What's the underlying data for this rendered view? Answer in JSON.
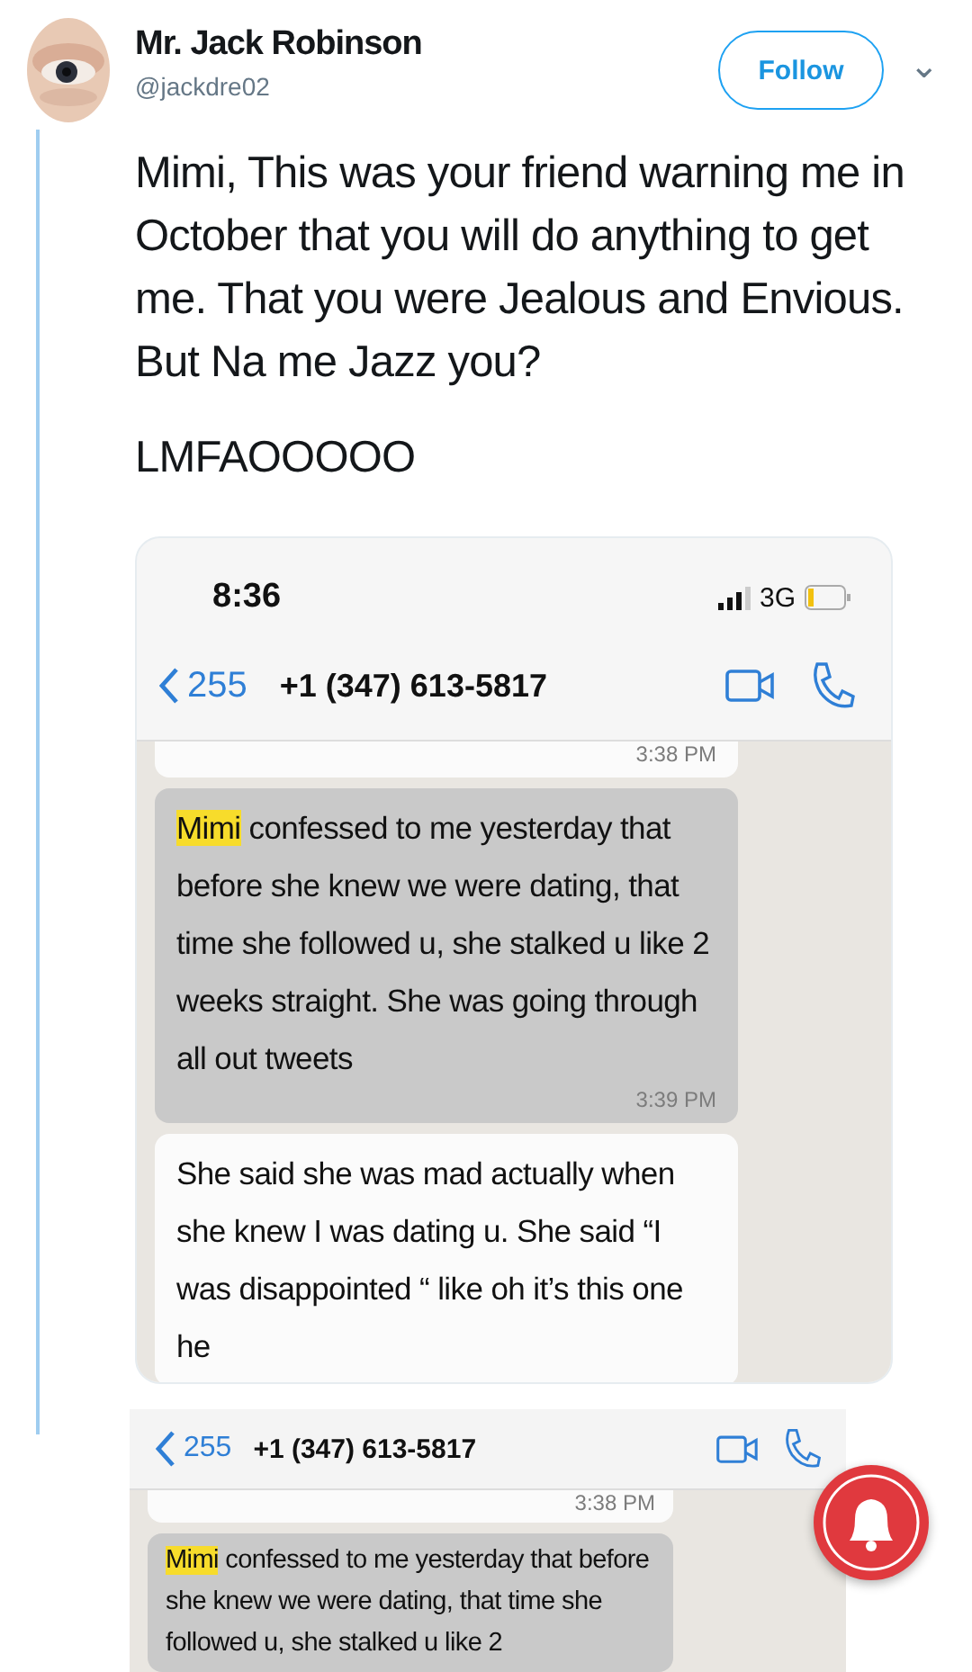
{
  "tweet": {
    "author": {
      "name": "Mr. Jack Robinson",
      "handle": "@jackdre02"
    },
    "follow_button": "Follow",
    "menu_caret": "⌄",
    "paragraphs": [
      "Mimi, This was your friend warning me in October that you will do anything to get me. That you were Jealous and Envious. But Na me Jazz you?",
      "LMFAOOOOO"
    ]
  },
  "screenshot": {
    "status_bar": {
      "time": "8:36",
      "network": "3G"
    },
    "chat_header": {
      "back_count": "255",
      "contact": "+1 (347) 613-5817"
    },
    "messages": [
      {
        "kind": "timestamp_only",
        "time": "3:38 PM"
      },
      {
        "kind": "highlighted",
        "highlight": "Mimi",
        "text": " confessed to me yesterday that before she knew we were dating, that time she followed u, she stalked u like 2 weeks straight. She was going through all out tweets",
        "time": "3:39 PM"
      },
      {
        "kind": "plain",
        "text": "She said she was mad actually when she knew I was dating u. She said “I was disappointed “ like oh it’s this one he"
      }
    ]
  },
  "second_screenshot": {
    "chat_header": {
      "back_count": "255",
      "contact": "+1 (347) 613-5817"
    },
    "messages": [
      {
        "kind": "timestamp_only",
        "time": "3:38 PM"
      },
      {
        "kind": "highlighted",
        "highlight": "Mimi",
        "text": " confessed to me yesterday that before she knew we were dating, that time she followed u, she stalked u like 2"
      }
    ]
  },
  "notification_button": {
    "kind": "bell"
  }
}
